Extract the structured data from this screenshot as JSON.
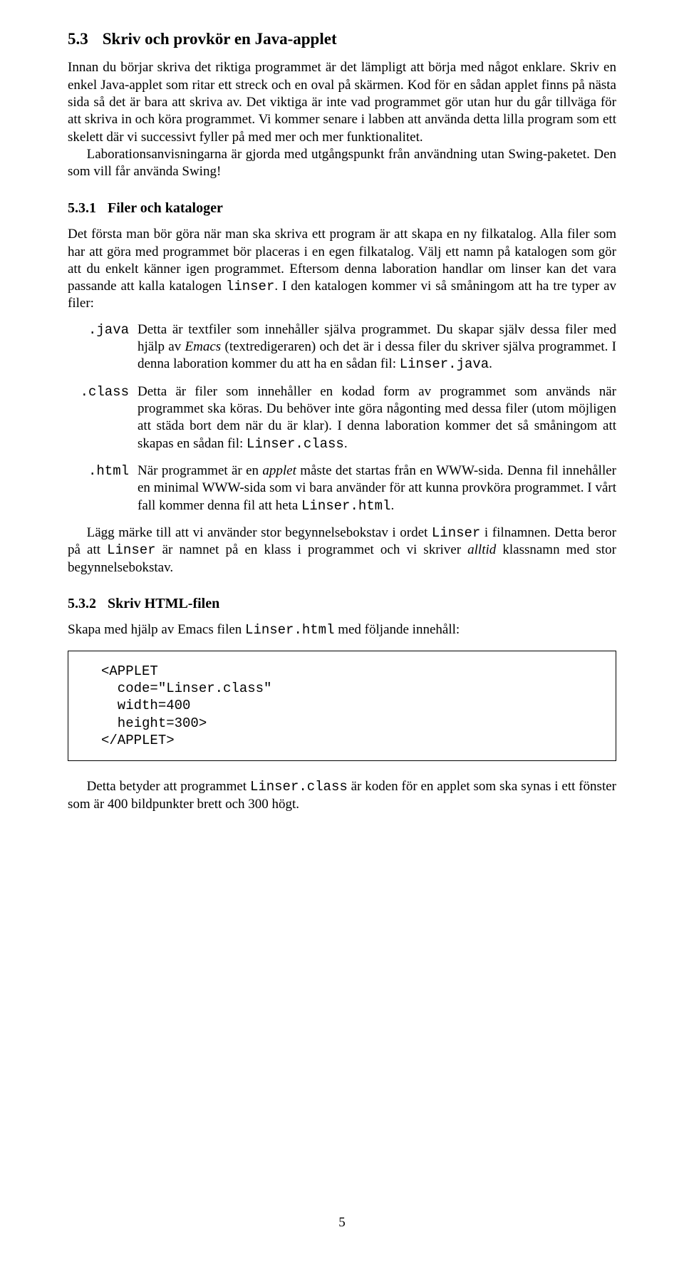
{
  "section53": {
    "number": "5.3",
    "title": "Skriv och provkör en Java-applet",
    "p1": "Innan du börjar skriva det riktiga programmet är det lämpligt att börja med något enklare. Skriv en enkel Java-applet som ritar ett streck och en oval på skärmen. Kod för en sådan applet finns på nästa sida så det är bara att skriva av. Det viktiga är inte vad programmet gör utan hur du går tillväga för att skriva in och köra programmet. Vi kommer senare i labben att använda detta lilla program som ett skelett där vi successivt fyller på med mer och mer funktionalitet.",
    "p2": "Laborationsanvisningarna är gjorda med utgångspunkt från användning utan Swing-paketet. Den som vill får använda Swing!"
  },
  "section531": {
    "number": "5.3.1",
    "title": "Filer och kataloger",
    "p1a": "Det första man bör göra när man ska skriva ett program är att skapa en ny filkatalog. Alla filer som har att göra med programmet bör placeras i en egen filkatalog. Välj ett namn på katalogen som gör att du enkelt känner igen programmet. Eftersom denna laboration handlar om linser kan det vara passande att kalla katalogen ",
    "p1_linser": "linser",
    "p1b": ". I den katalogen kommer vi så småningom att ha tre typer av filer:",
    "dl": [
      {
        "term": ".java",
        "def_a": "Detta är textfiler som innehåller själva programmet. Du skapar själv dessa filer med hjälp av ",
        "def_em": "Emacs",
        "def_b": " (textredigeraren) och det är i dessa filer du skriver själva programmet. I denna laboration kommer du att ha en sådan fil: ",
        "def_tt": "Linser.java",
        "def_c": "."
      },
      {
        "term": ".class",
        "def_a": "Detta är filer som innehåller en kodad form av programmet som används när programmet ska köras. Du behöver inte göra någonting med dessa filer (utom möjligen att städa bort dem när du är klar). I denna laboration kommer det så småningom att skapas en sådan fil: ",
        "def_tt": "Linser.class",
        "def_c": "."
      },
      {
        "term": ".html",
        "def_a": "När programmet är en ",
        "def_em": "applet",
        "def_b": " måste det startas från en WWW-sida. Denna fil innehåller en minimal WWW-sida som vi bara använder för att kunna provköra programmet. I vårt fall kommer denna fil att heta ",
        "def_tt": "Linser.html",
        "def_c": "."
      }
    ],
    "after1a": "Lägg märke till att vi använder stor begynnelsebokstav i ordet ",
    "after1_tt1": "Linser",
    "after1b": " i filnamnen. Detta beror på att ",
    "after1_tt2": "Linser",
    "after1c": " är namnet på en klass i programmet och vi skriver ",
    "after1_em": "alltid",
    "after1d": " klassnamn med stor begynnelsebokstav."
  },
  "section532": {
    "number": "5.3.2",
    "title": "Skriv HTML-filen",
    "p1a": "Skapa med hjälp av Emacs filen ",
    "p1_tt": "Linser.html",
    "p1b": " med följande innehåll:",
    "code": "<APPLET\n  code=\"Linser.class\"\n  width=400\n  height=300>\n</APPLET>",
    "p2a": "Detta betyder att programmet ",
    "p2_tt": "Linser.class",
    "p2b": " är koden för en applet som ska synas i ett fönster som är 400 bildpunkter brett och 300 högt."
  },
  "pagenum": "5"
}
